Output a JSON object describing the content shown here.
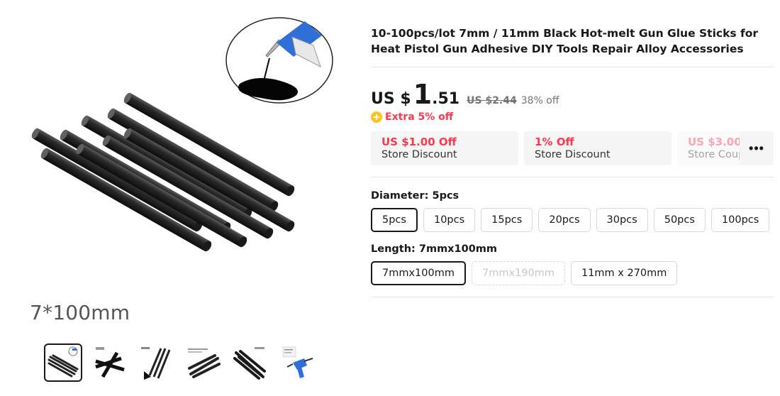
{
  "product": {
    "title": "10-100pcs/lot 7mm / 11mm Black Hot-melt Gun Glue Sticks for Heat Pistol Gun Adhesive DIY Tools Repair Alloy Accessories",
    "image_caption": "7*100mm"
  },
  "price": {
    "currency": "US $",
    "integer": "1",
    "decimal": ".51",
    "original": "US $2.44",
    "discount": "38% off",
    "extra": "Extra 5% off"
  },
  "coupons": [
    {
      "amount": "US $1.00 Off",
      "label": "Store Discount"
    },
    {
      "amount": "1% Off",
      "label": "Store Discount"
    },
    {
      "amount": "US $3.00",
      "label": "Store Coupon"
    }
  ],
  "more_button": "•••",
  "sku": {
    "diameter": {
      "title": "Diameter: 5pcs",
      "options": [
        "5pcs",
        "10pcs",
        "15pcs",
        "20pcs",
        "30pcs",
        "50pcs",
        "100pcs"
      ],
      "selected_index": 0
    },
    "length": {
      "title": "Length: 7mmx100mm",
      "options": [
        "7mmx100mm",
        "7mmx190mm",
        "11mm x 270mm"
      ],
      "selected_index": 0,
      "disabled_index": 1
    }
  },
  "icons": {
    "extra": "coin-plus-icon",
    "more": "more-dots-icon"
  },
  "colors": {
    "accent_red": "#fd384f",
    "coin_yellow": "#ffc319",
    "glue_gun_blue": "#2f6fd8"
  }
}
